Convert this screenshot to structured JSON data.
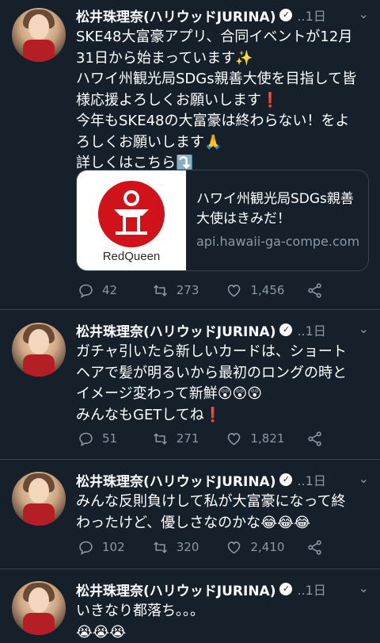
{
  "colors": {
    "background": "#15202b",
    "divider": "#38444d",
    "secondary_text": "#8899a6",
    "logo_red": "#d0121b"
  },
  "icons": {
    "reply": "reply-icon",
    "retweet": "retweet-icon",
    "like": "heart-icon",
    "share": "share-icon",
    "menu": "chevron-down-icon",
    "verified": "verified-badge-icon"
  },
  "tweets": [
    {
      "name": "松井珠理奈(ハリウッドJURINA)",
      "time": "..1日",
      "lines": [
        "SKE48大富豪アプリ、合同イベントが12月",
        "31日から始まっています✨",
        "ハワイ州観光局SDGs親善大使を目指して皆",
        "様応援よろしくお願いします❗",
        "今年もSKE48の大富豪は終わらない！をよ",
        "ろしくお願いします🙏",
        "詳しくはこちら⤵️"
      ],
      "card": {
        "title_line1": "ハワイ州観光局SDGs親善",
        "title_line2": "大使はきみだ！",
        "domain": "api.hawaii-ga-compe.com",
        "logo_text": "RedQueen"
      },
      "replies": "42",
      "retweets": "273",
      "likes": "1,456"
    },
    {
      "name": "松井珠理奈(ハリウッドJURINA)",
      "time": "..1日",
      "lines": [
        "ガチャ引いたら新しいカードは、ショート",
        "ヘアで髪が明るいから最初のロングの時と",
        "イメージ変わって新鮮😲😲😲",
        "みんなもGETしてね❗"
      ],
      "replies": "51",
      "retweets": "271",
      "likes": "1,821"
    },
    {
      "name": "松井珠理奈(ハリウッドJURINA)",
      "time": "..1日",
      "lines": [
        "みんな反則負けして私が大富豪になって終",
        "わったけど、優しさなのかな😂😂😂"
      ],
      "replies": "102",
      "retweets": "320",
      "likes": "2,410"
    },
    {
      "name": "松井珠理奈(ハリウッドJURINA)",
      "time": "..1日",
      "lines": [
        "いきなり都落ち。。。",
        "😭😭😭"
      ]
    }
  ]
}
